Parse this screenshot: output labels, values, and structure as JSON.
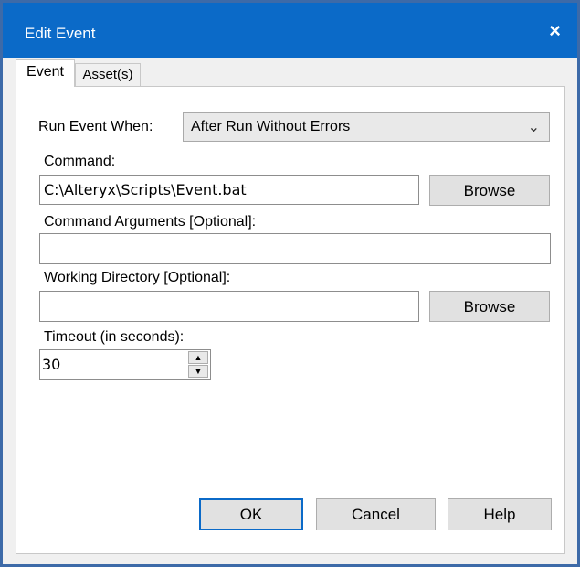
{
  "window": {
    "title": "Edit Event",
    "close_icon": "×"
  },
  "tabs": [
    {
      "label": "Event"
    },
    {
      "label": "Asset(s)"
    }
  ],
  "form": {
    "run_event_label": "Run Event When:",
    "run_event_value": "After Run Without Errors",
    "command_label": "Command:",
    "command_value": "C:\\Alteryx\\Scripts\\Event.bat",
    "command_browse": "Browse",
    "args_label": "Command Arguments [Optional]:",
    "args_value": "",
    "workdir_label": "Working Directory [Optional]:",
    "workdir_value": "",
    "workdir_browse": "Browse",
    "timeout_label": "Timeout (in seconds):",
    "timeout_value": "30"
  },
  "buttons": {
    "ok": "OK",
    "cancel": "Cancel",
    "help": "Help"
  }
}
